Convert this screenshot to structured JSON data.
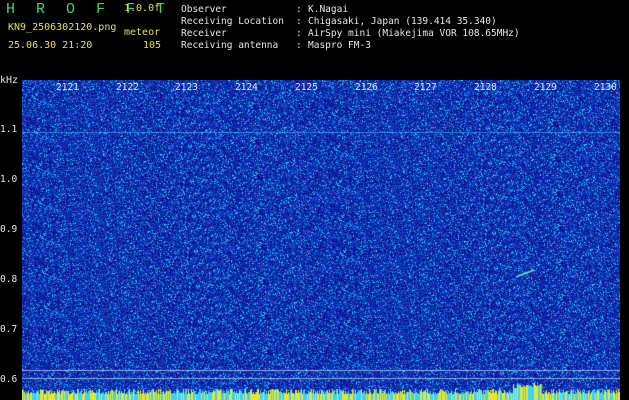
{
  "header": {
    "app_title": "H R O F F T",
    "version": "1.0.0f",
    "filename": "KN9_2506302120.png",
    "mode": "meteor",
    "datetime": "25.06.30 21:20",
    "count": "105"
  },
  "info": [
    {
      "label": "Observer",
      "value": "K.Nagai"
    },
    {
      "label": "Receiving Location",
      "value": "Chigasaki, Japan (139.414 35.340)"
    },
    {
      "label": "Receiver",
      "value": "AirSpy mini (Miakejima VOR 108.65MHz)"
    },
    {
      "label": "Receiving antenna",
      "value": "Maspro FM-3"
    }
  ],
  "axis": {
    "unit": "kHz",
    "time_ticks": [
      "2121",
      "2122",
      "2123",
      "2124",
      "2125",
      "2126",
      "2127",
      "2128",
      "2129",
      "2130"
    ],
    "freq_ticks": [
      "1.1",
      "1.0",
      "0.9",
      "0.8",
      "0.7",
      "0.6"
    ]
  },
  "colors": {
    "background": "#1020a8",
    "noise": "#2ad0ff",
    "bottom_band": "#e6e62a",
    "text_label": "#e6e24a"
  }
}
